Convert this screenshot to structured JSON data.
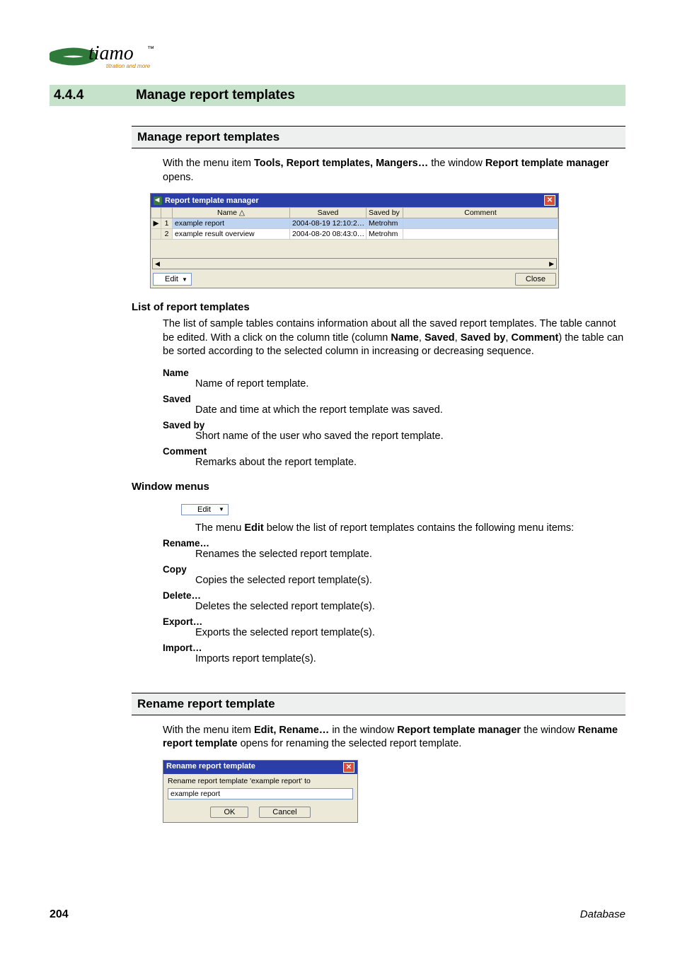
{
  "logo_brand": "tiamo",
  "logo_tag": "titration and more",
  "section": {
    "number": "4.4.4",
    "title": "Manage report templates"
  },
  "h_manage": "Manage report templates",
  "p_intro_1": "With the menu item ",
  "p_intro_bold_1": "Tools, Report templates, Mangers…",
  "p_intro_2": " the window ",
  "p_intro_bold_2": "Report template manager",
  "p_intro_3": " opens.",
  "ss1": {
    "title": "Report template manager",
    "cols": {
      "name": "Name △",
      "saved": "Saved",
      "savedby": "Saved by",
      "comment": "Comment"
    },
    "rows": [
      {
        "idx": "1",
        "ptr": "▶",
        "name": "example report",
        "saved": "2004-08-19 12:10:2…",
        "savedby": "Metrohm",
        "comment": "",
        "selected": true
      },
      {
        "idx": "2",
        "ptr": "",
        "name": "example result overview",
        "saved": "2004-08-20 08:43:0…",
        "savedby": "Metrohm",
        "comment": "",
        "selected": false
      }
    ],
    "scroll_left": "◀",
    "scroll_right": "▶",
    "edit_label": "Edit",
    "close_label": "Close"
  },
  "h_list": "List of report templates",
  "p_list_1a": "The list of sample tables contains information about all the saved report templates. The table cannot be edited. With a click on the column title (column ",
  "p_list_b1": "Name",
  "p_list_sep": ", ",
  "p_list_b2": "Saved",
  "p_list_b3": "Saved by",
  "p_list_b4": "Comment",
  "p_list_1b": ") the table can be sorted according to the selected column in increasing or decreasing sequence.",
  "defs": {
    "name_t": "Name",
    "name_d": "Name of report template.",
    "saved_t": "Saved",
    "saved_d": "Date and time at which the report template was saved.",
    "savedby_t": "Saved by",
    "savedby_d": "Short name of the user who saved the report template.",
    "comment_t": "Comment",
    "comment_d": "Remarks about the report template."
  },
  "h_window": "Window menus",
  "edit_standalone": "Edit",
  "p_edit_1": "The menu ",
  "p_edit_bold": "Edit",
  "p_edit_2": " below the list of report templates contains the following menu items:",
  "menu": {
    "rename_t": "Rename…",
    "rename_d": "Renames the selected report template.",
    "copy_t": "Copy",
    "copy_d": "Copies the selected report template(s).",
    "delete_t": "Delete…",
    "delete_d": "Deletes the selected report template(s).",
    "export_t": "Export…",
    "export_d": "Exports the selected report template(s).",
    "import_t": "Import…",
    "import_d": "Imports report template(s)."
  },
  "h_rename": "Rename report template",
  "p_ren_1": "With the menu item ",
  "p_ren_b1": "Edit, Rename…",
  "p_ren_2": " in the window ",
  "p_ren_b2": "Report template manager",
  "p_ren_3": " the window ",
  "p_ren_b3": "Rename report template",
  "p_ren_4": " opens for renaming the selected report template.",
  "ss2": {
    "title": "Rename report template",
    "label": "Rename report template 'example report'  to",
    "value": "example report",
    "ok": "OK",
    "cancel": "Cancel"
  },
  "footer": {
    "page": "204",
    "db": "Database"
  }
}
